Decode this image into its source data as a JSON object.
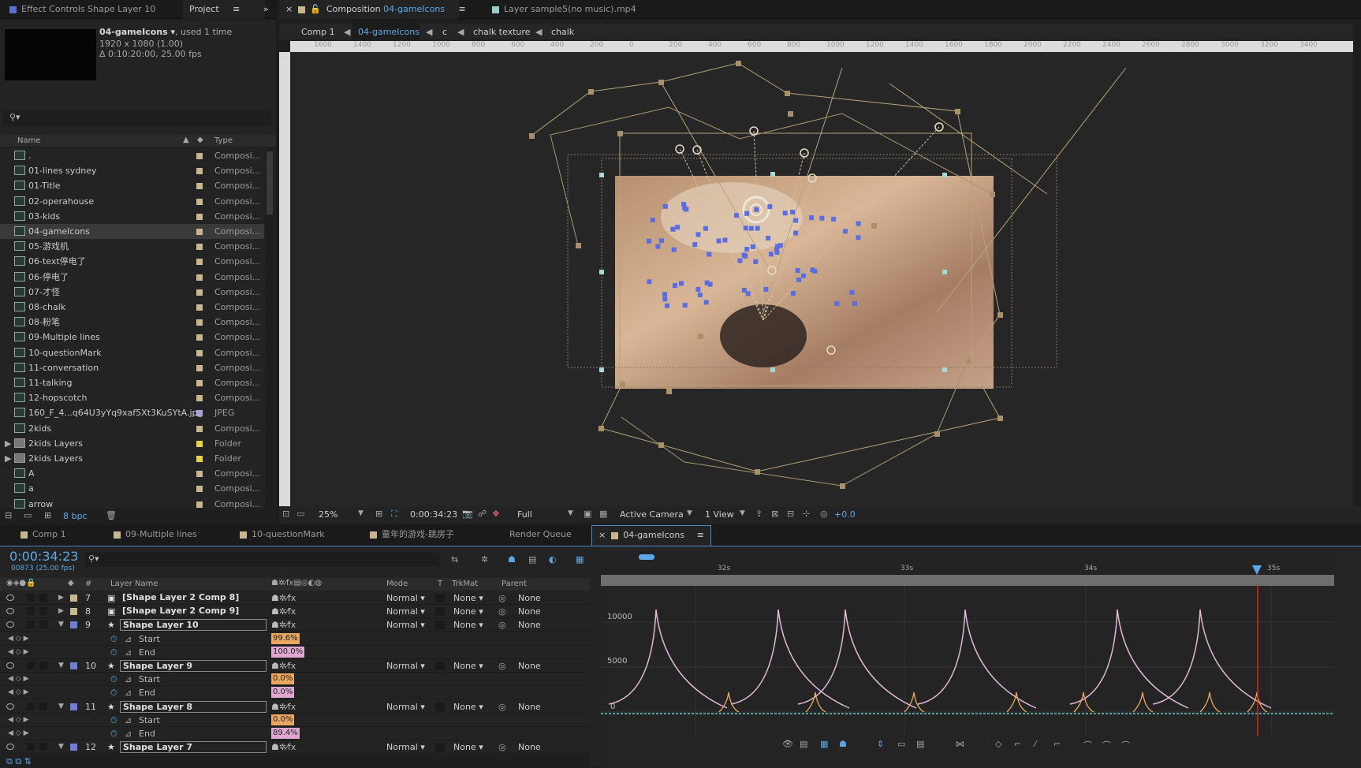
{
  "left_panel": {
    "tab_effect": "Effect Controls Shape Layer 10",
    "tab_project": "Project"
  },
  "project": {
    "selected_name": "04-gameIcons ▾",
    "used": ", used 1 time",
    "resolution": "1920 x 1080 (1.00)",
    "duration": "Δ 0:10:20:00, 25.00 fps",
    "search_placeholder": "",
    "col_name": "Name",
    "col_type": "Type",
    "items": [
      {
        "name": ".",
        "type": "Composi...",
        "color": "#c8b68f"
      },
      {
        "name": "01-lines sydney",
        "type": "Composi...",
        "color": "#c8b68f"
      },
      {
        "name": "01-Title",
        "type": "Composi...",
        "color": "#c8b68f"
      },
      {
        "name": "02-operahouse",
        "type": "Composi...",
        "color": "#c8b68f"
      },
      {
        "name": "03-kids",
        "type": "Composi...",
        "color": "#c8b68f"
      },
      {
        "name": "04-gameIcons",
        "type": "Composi...",
        "color": "#c8b68f"
      },
      {
        "name": "05-游戏机",
        "type": "Composi...",
        "color": "#c8b68f"
      },
      {
        "name": "06-text停电了",
        "type": "Composi...",
        "color": "#c8b68f"
      },
      {
        "name": "06-停电了",
        "type": "Composi...",
        "color": "#c8b68f"
      },
      {
        "name": "07-才怪",
        "type": "Composi...",
        "color": "#c8b68f"
      },
      {
        "name": "08-chalk",
        "type": "Composi...",
        "color": "#c8b68f"
      },
      {
        "name": "08-粉笔",
        "type": "Composi...",
        "color": "#c8b68f"
      },
      {
        "name": "09-Multiple lines",
        "type": "Composi...",
        "color": "#c8b68f"
      },
      {
        "name": "10-questionMark",
        "type": "Composi...",
        "color": "#c8b68f"
      },
      {
        "name": "11-conversation",
        "type": "Composi...",
        "color": "#c8b68f"
      },
      {
        "name": "11-talking",
        "type": "Composi...",
        "color": "#c8b68f"
      },
      {
        "name": "12-hopscotch",
        "type": "Composi...",
        "color": "#c8b68f"
      },
      {
        "name": "160_F_4...q64U3yYq9xaf5Xt3KuSYtA.jpg",
        "type": "JPEG",
        "color": "#a8a0d8"
      },
      {
        "name": "2kids",
        "type": "Composi...",
        "color": "#c8b68f"
      },
      {
        "name": "2kids Layers",
        "type": "Folder",
        "color": "#e6d34a"
      },
      {
        "name": "2kids Layers",
        "type": "Folder",
        "color": "#e6d34a"
      },
      {
        "name": "A",
        "type": "Composi...",
        "color": "#c8b68f"
      },
      {
        "name": "a",
        "type": "Composi...",
        "color": "#c8b68f"
      },
      {
        "name": "arrow",
        "type": "Composi...",
        "color": "#c8b68f"
      }
    ],
    "bpc": "8 bpc"
  },
  "comp_panel": {
    "tab_comp_prefix": "Composition",
    "tab_comp_name": "04-gameIcons",
    "tab_layer": "Layer sample5(no music).mp4",
    "crumbs": [
      "Comp 1",
      "04-gameIcons",
      "c",
      "chalk texture",
      "chalk"
    ],
    "ruler": [
      "1600",
      "1400",
      "1200",
      "1000",
      "800",
      "600",
      "400",
      "200",
      "0",
      "200",
      "400",
      "600",
      "800",
      "1000",
      "1200",
      "1400",
      "1600",
      "1800",
      "2000",
      "2200",
      "2400",
      "2600",
      "2800",
      "3000",
      "3200",
      "3400"
    ],
    "zoom": "25%",
    "timecode": "0:00:34:23",
    "resolution": "Full",
    "camera": "Active Camera",
    "views": "1 View",
    "exposure": "+0.0"
  },
  "timeline": {
    "tabs": [
      "Comp 1",
      "09-Multiple lines",
      "10-questionMark",
      "童年的游戏-跳房子",
      "Render Queue",
      "04-gameIcons"
    ],
    "tab_colors": [
      "#c8b68f",
      "#c8b68f",
      "#c8b68f",
      "#c8b68f",
      "",
      "#c8b68f"
    ],
    "time": "0:00:34:23",
    "frames": "00873 (25.00 fps)",
    "col_layer": "Layer Name",
    "col_mode": "Mode",
    "col_t": "T",
    "col_trkmat": "TrkMat",
    "col_parent": "Parent",
    "rows": [
      {
        "kind": "layer",
        "num": "7",
        "name": "[Shape Layer 2 Comp 8]",
        "mode": "Normal",
        "trk": "None",
        "parent": "None",
        "color": "#c8b68f",
        "expanded": false
      },
      {
        "kind": "layer",
        "num": "8",
        "name": "[Shape Layer 2 Comp 9]",
        "mode": "Normal",
        "trk": "None",
        "parent": "None",
        "color": "#c8b68f",
        "expanded": false
      },
      {
        "kind": "layer",
        "num": "9",
        "name": "Shape Layer 10",
        "mode": "Normal",
        "trk": "None",
        "parent": "None",
        "color": "#6f7fd6",
        "expanded": true
      },
      {
        "kind": "prop",
        "name": "Start",
        "value": "99.6%",
        "color": "#e8a862"
      },
      {
        "kind": "prop",
        "name": "End",
        "value": "100.0%",
        "color": "#e0a8d0"
      },
      {
        "kind": "layer",
        "num": "10",
        "name": "Shape Layer 9",
        "mode": "Normal",
        "trk": "None",
        "parent": "None",
        "color": "#6f7fd6",
        "expanded": true
      },
      {
        "kind": "prop",
        "name": "Start",
        "value": "0.0%",
        "color": "#e8a862"
      },
      {
        "kind": "prop",
        "name": "End",
        "value": "0.0%",
        "color": "#e0a8d0"
      },
      {
        "kind": "layer",
        "num": "11",
        "name": "Shape Layer 8",
        "mode": "Normal",
        "trk": "None",
        "parent": "None",
        "color": "#6f7fd6",
        "expanded": true
      },
      {
        "kind": "prop",
        "name": "Start",
        "value": "0.0%",
        "color": "#e8a862"
      },
      {
        "kind": "prop",
        "name": "End",
        "value": "89.4%",
        "color": "#e0a8d0"
      },
      {
        "kind": "layer",
        "num": "12",
        "name": "Shape Layer 7",
        "mode": "Normal",
        "trk": "None",
        "parent": "None",
        "color": "#6f7fd6",
        "expanded": true
      }
    ],
    "time_labels": [
      "32s",
      "33s",
      "34s",
      "35s"
    ],
    "graph_labels": [
      "10000",
      "5000",
      "0"
    ]
  }
}
